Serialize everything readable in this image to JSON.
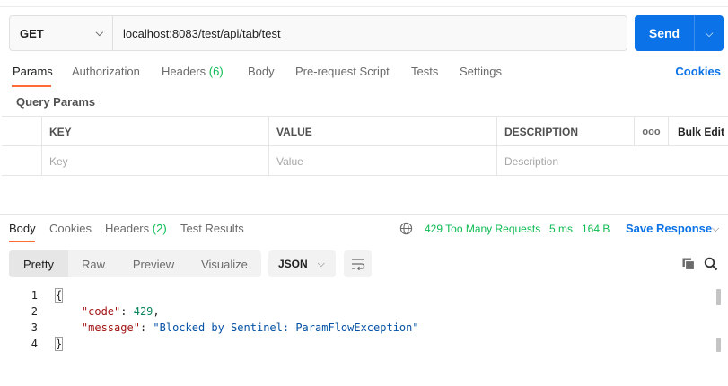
{
  "request": {
    "method": "GET",
    "url": "localhost:8083/test/api/tab/test",
    "send_label": "Send"
  },
  "request_tabs": {
    "params": "Params",
    "authorization": "Authorization",
    "headers": "Headers",
    "headers_count": "(6)",
    "body": "Body",
    "prerequest": "Pre-request Script",
    "tests": "Tests",
    "settings": "Settings",
    "cookies": "Cookies"
  },
  "query_params": {
    "title": "Query Params",
    "columns": [
      "KEY",
      "VALUE",
      "DESCRIPTION"
    ],
    "more": "ooo",
    "bulk_edit": "Bulk Edit",
    "placeholders": [
      "Key",
      "Value",
      "Description"
    ]
  },
  "response_tabs": {
    "body": "Body",
    "cookies": "Cookies",
    "headers": "Headers",
    "headers_count": "(2)",
    "test_results": "Test Results"
  },
  "response_status": {
    "status": "429 Too Many Requests",
    "time": "5 ms",
    "size": "164 B",
    "save": "Save Response",
    "color": "#0cbb52"
  },
  "format_bar": {
    "options": [
      "Pretty",
      "Raw",
      "Preview",
      "Visualize"
    ],
    "selected": "Pretty",
    "language": "JSON"
  },
  "code": {
    "line_numbers": [
      "1",
      "2",
      "3",
      "4"
    ],
    "open": "{",
    "close": "}",
    "code_key": "\"code\"",
    "code_value": "429",
    "message_key": "\"message\"",
    "message_value": "\"Blocked by Sentinel: ParamFlowException\""
  },
  "colors": {
    "accent": "#ff6c37",
    "brand_blue": "#0b72e7"
  }
}
